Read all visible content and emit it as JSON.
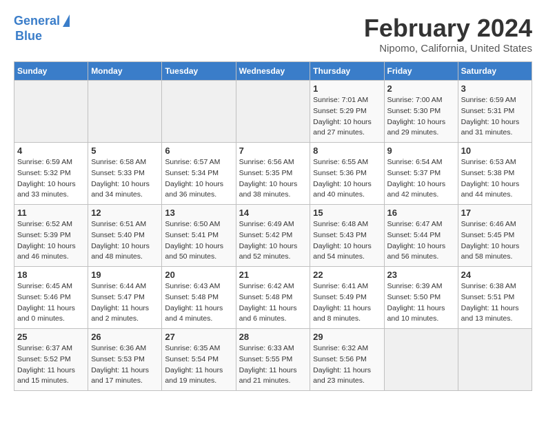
{
  "header": {
    "logo_line1": "General",
    "logo_line2": "Blue",
    "title": "February 2024",
    "subtitle": "Nipomo, California, United States"
  },
  "weekdays": [
    "Sunday",
    "Monday",
    "Tuesday",
    "Wednesday",
    "Thursday",
    "Friday",
    "Saturday"
  ],
  "weeks": [
    [
      {
        "day": "",
        "info": ""
      },
      {
        "day": "",
        "info": ""
      },
      {
        "day": "",
        "info": ""
      },
      {
        "day": "",
        "info": ""
      },
      {
        "day": "1",
        "info": "Sunrise: 7:01 AM\nSunset: 5:29 PM\nDaylight: 10 hours\nand 27 minutes."
      },
      {
        "day": "2",
        "info": "Sunrise: 7:00 AM\nSunset: 5:30 PM\nDaylight: 10 hours\nand 29 minutes."
      },
      {
        "day": "3",
        "info": "Sunrise: 6:59 AM\nSunset: 5:31 PM\nDaylight: 10 hours\nand 31 minutes."
      }
    ],
    [
      {
        "day": "4",
        "info": "Sunrise: 6:59 AM\nSunset: 5:32 PM\nDaylight: 10 hours\nand 33 minutes."
      },
      {
        "day": "5",
        "info": "Sunrise: 6:58 AM\nSunset: 5:33 PM\nDaylight: 10 hours\nand 34 minutes."
      },
      {
        "day": "6",
        "info": "Sunrise: 6:57 AM\nSunset: 5:34 PM\nDaylight: 10 hours\nand 36 minutes."
      },
      {
        "day": "7",
        "info": "Sunrise: 6:56 AM\nSunset: 5:35 PM\nDaylight: 10 hours\nand 38 minutes."
      },
      {
        "day": "8",
        "info": "Sunrise: 6:55 AM\nSunset: 5:36 PM\nDaylight: 10 hours\nand 40 minutes."
      },
      {
        "day": "9",
        "info": "Sunrise: 6:54 AM\nSunset: 5:37 PM\nDaylight: 10 hours\nand 42 minutes."
      },
      {
        "day": "10",
        "info": "Sunrise: 6:53 AM\nSunset: 5:38 PM\nDaylight: 10 hours\nand 44 minutes."
      }
    ],
    [
      {
        "day": "11",
        "info": "Sunrise: 6:52 AM\nSunset: 5:39 PM\nDaylight: 10 hours\nand 46 minutes."
      },
      {
        "day": "12",
        "info": "Sunrise: 6:51 AM\nSunset: 5:40 PM\nDaylight: 10 hours\nand 48 minutes."
      },
      {
        "day": "13",
        "info": "Sunrise: 6:50 AM\nSunset: 5:41 PM\nDaylight: 10 hours\nand 50 minutes."
      },
      {
        "day": "14",
        "info": "Sunrise: 6:49 AM\nSunset: 5:42 PM\nDaylight: 10 hours\nand 52 minutes."
      },
      {
        "day": "15",
        "info": "Sunrise: 6:48 AM\nSunset: 5:43 PM\nDaylight: 10 hours\nand 54 minutes."
      },
      {
        "day": "16",
        "info": "Sunrise: 6:47 AM\nSunset: 5:44 PM\nDaylight: 10 hours\nand 56 minutes."
      },
      {
        "day": "17",
        "info": "Sunrise: 6:46 AM\nSunset: 5:45 PM\nDaylight: 10 hours\nand 58 minutes."
      }
    ],
    [
      {
        "day": "18",
        "info": "Sunrise: 6:45 AM\nSunset: 5:46 PM\nDaylight: 11 hours\nand 0 minutes."
      },
      {
        "day": "19",
        "info": "Sunrise: 6:44 AM\nSunset: 5:47 PM\nDaylight: 11 hours\nand 2 minutes."
      },
      {
        "day": "20",
        "info": "Sunrise: 6:43 AM\nSunset: 5:48 PM\nDaylight: 11 hours\nand 4 minutes."
      },
      {
        "day": "21",
        "info": "Sunrise: 6:42 AM\nSunset: 5:48 PM\nDaylight: 11 hours\nand 6 minutes."
      },
      {
        "day": "22",
        "info": "Sunrise: 6:41 AM\nSunset: 5:49 PM\nDaylight: 11 hours\nand 8 minutes."
      },
      {
        "day": "23",
        "info": "Sunrise: 6:39 AM\nSunset: 5:50 PM\nDaylight: 11 hours\nand 10 minutes."
      },
      {
        "day": "24",
        "info": "Sunrise: 6:38 AM\nSunset: 5:51 PM\nDaylight: 11 hours\nand 13 minutes."
      }
    ],
    [
      {
        "day": "25",
        "info": "Sunrise: 6:37 AM\nSunset: 5:52 PM\nDaylight: 11 hours\nand 15 minutes."
      },
      {
        "day": "26",
        "info": "Sunrise: 6:36 AM\nSunset: 5:53 PM\nDaylight: 11 hours\nand 17 minutes."
      },
      {
        "day": "27",
        "info": "Sunrise: 6:35 AM\nSunset: 5:54 PM\nDaylight: 11 hours\nand 19 minutes."
      },
      {
        "day": "28",
        "info": "Sunrise: 6:33 AM\nSunset: 5:55 PM\nDaylight: 11 hours\nand 21 minutes."
      },
      {
        "day": "29",
        "info": "Sunrise: 6:32 AM\nSunset: 5:56 PM\nDaylight: 11 hours\nand 23 minutes."
      },
      {
        "day": "",
        "info": ""
      },
      {
        "day": "",
        "info": ""
      }
    ]
  ]
}
